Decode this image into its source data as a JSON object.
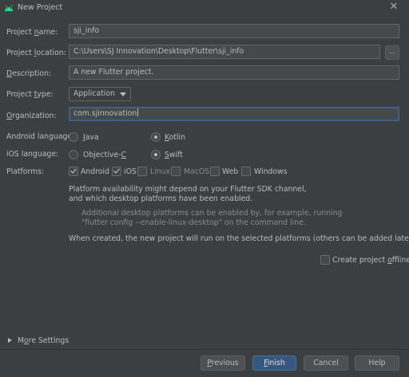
{
  "window": {
    "title": "New Project",
    "close_glyph": "✕",
    "app_icon": "android-icon"
  },
  "form": {
    "project_name": {
      "label_before": "Project ",
      "label_mnemonic": "n",
      "label_after": "ame:",
      "value": "sji_info"
    },
    "project_location": {
      "label_before": "Project ",
      "label_mnemonic": "l",
      "label_after": "ocation:",
      "value": "C:\\Users\\SJ Innovation\\Desktop\\Flutter\\sji_info",
      "browse_label": "..."
    },
    "description": {
      "label_before": "",
      "label_mnemonic": "D",
      "label_after": "escription:",
      "value": "A new Flutter project."
    },
    "project_type": {
      "label_before": "Project ",
      "label_mnemonic": "t",
      "label_after": "ype:",
      "value": "Application"
    },
    "organization": {
      "label_before": "",
      "label_mnemonic": "O",
      "label_after": "rganization:",
      "value": "com.sjinnovation"
    }
  },
  "android_language": {
    "label": "Android language:",
    "options": [
      {
        "before": "",
        "mnemonic": "J",
        "after": "ava",
        "selected": false
      },
      {
        "before": "",
        "mnemonic": "K",
        "after": "otlin",
        "selected": true
      }
    ]
  },
  "ios_language": {
    "label": "iOS language:",
    "options": [
      {
        "before": "Objective-",
        "mnemonic": "C",
        "after": "",
        "selected": false
      },
      {
        "before": "",
        "mnemonic": "S",
        "after": "wift",
        "selected": true
      }
    ]
  },
  "platforms": {
    "label": "Platforms:",
    "items": [
      {
        "label": "Android",
        "checked": true,
        "enabled": true
      },
      {
        "label": "iOS",
        "checked": true,
        "enabled": true
      },
      {
        "label": "Linux",
        "checked": false,
        "enabled": false
      },
      {
        "label": "MacOS",
        "checked": false,
        "enabled": false
      },
      {
        "label": "Web",
        "checked": false,
        "enabled": true
      },
      {
        "label": "Windows",
        "checked": false,
        "enabled": true
      }
    ]
  },
  "info": {
    "line1": "Platform availability might depend on your Flutter SDK channel,",
    "line2": "and which desktop platforms have been enabled.",
    "hint1": "Additional desktop platforms can be enabled by, for example, running",
    "hint2": "\"flutter config --enable-linux-desktop\" on the command line.",
    "line3": "When created, the new project will run on the selected platforms (others can be added later)."
  },
  "create_offline": {
    "before": "Create project ",
    "mnemonic": "o",
    "after": "ffline",
    "checked": false
  },
  "more_settings": {
    "before": "M",
    "mnemonic": "o",
    "after": "re Settings"
  },
  "buttons": {
    "previous": {
      "before": "",
      "mnemonic": "P",
      "after": "revious"
    },
    "finish": {
      "before": "",
      "mnemonic": "F",
      "after": "inish"
    },
    "cancel": "Cancel",
    "help": "Help"
  },
  "colors": {
    "background": "#3c3f41",
    "field_bg": "#45494a",
    "focus_border": "#3d6185",
    "primary_button": "#365880",
    "android_green": "#3ddc84"
  }
}
